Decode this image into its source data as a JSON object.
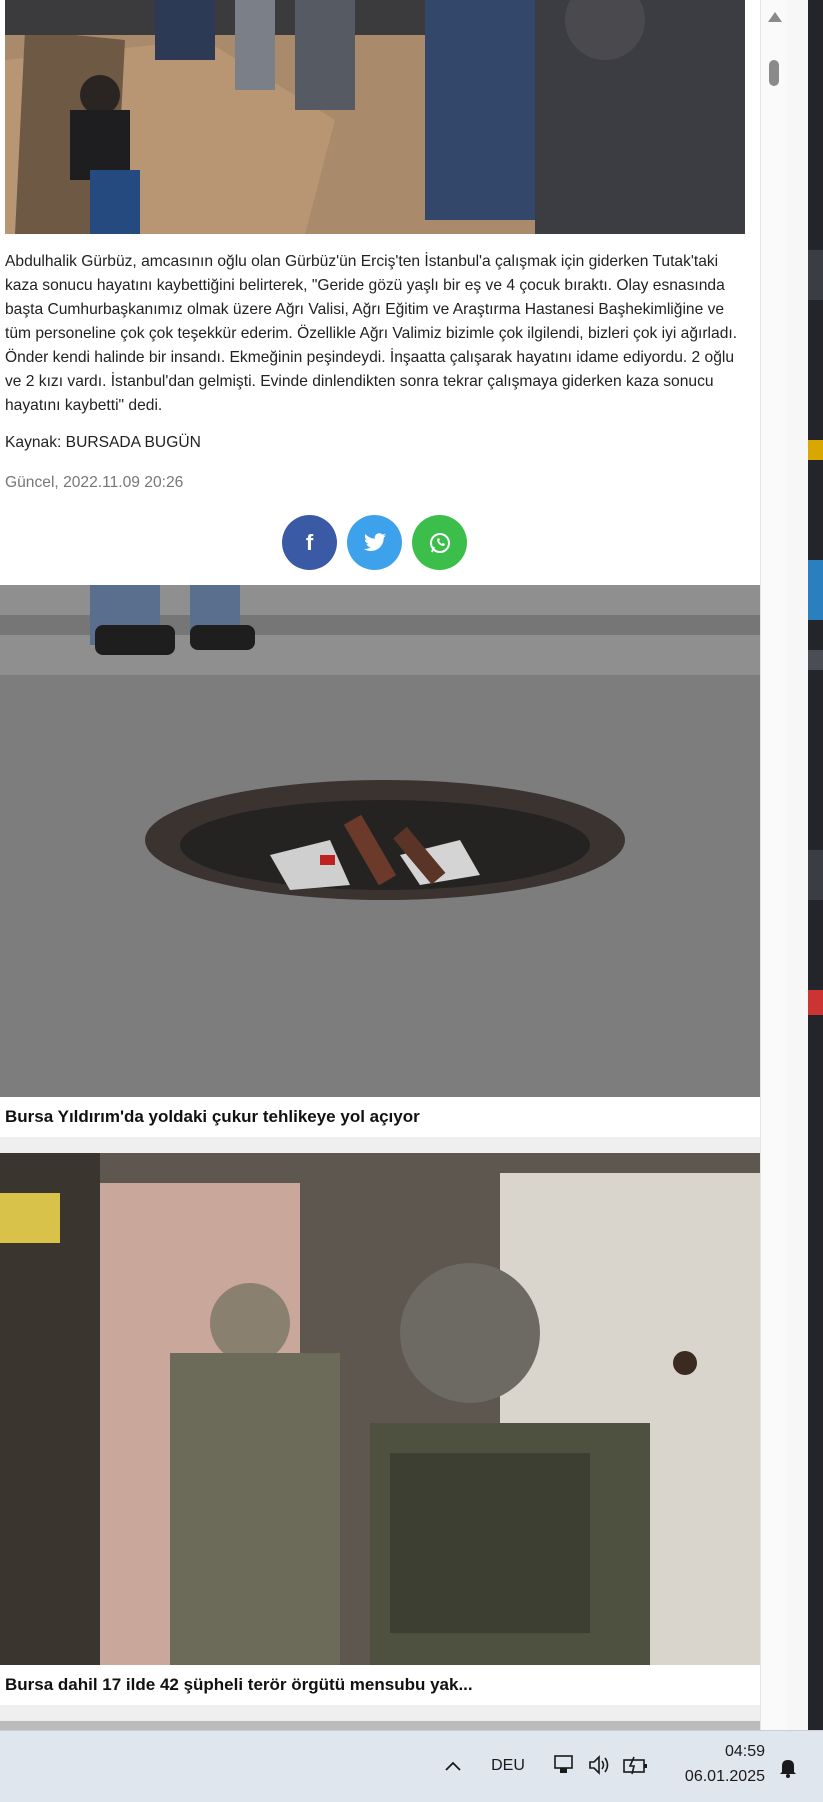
{
  "article": {
    "body": "Abdulhalik Gürbüz, amcasının oğlu olan Gürbüz'ün Erciş'ten İstanbul'a çalışmak için giderken Tutak'taki kaza sonucu hayatını kaybettiğini belirterek, \"Geride gözü yaşlı bir eş ve 4 çocuk bıraktı. Olay esnasında başta Cumhurbaşkanımız olmak üzere Ağrı Valisi, Ağrı Eğitim ve Araştırma Hastanesi Başhekimliğine ve tüm personeline çok çok teşekkür ederim. Özellikle Ağrı Valimiz bizimle çok ilgilendi, bizleri çok iyi ağırladı. Önder kendi halinde bir insandı. Ekmeğinin peşindeydi. İnşaatta çalışarak hayatını idame ediyordu. 2 oğlu ve 2 kızı vardı. İstanbul'dan gelmişti. Evinde dinlendikten sonra tekrar çalışmaya giderken kaza sonucu hayatını kaybetti\" dedi.",
    "source": "Kaynak: BURSADA BUGÜN",
    "updated": "Güncel, 2022.11.09 20:26"
  },
  "share": {
    "facebook": "f",
    "twitter": "twitter-icon",
    "whatsapp": "whatsapp-icon"
  },
  "related": [
    {
      "title": "Bursa Yıldırım'da yoldaki çukur tehlikeye yol açıyor"
    },
    {
      "title": "Bursa dahil 17 ilde 42 şüpheli terör örgütü mensubu yak..."
    }
  ],
  "taskbar": {
    "language": "DEU",
    "time": "04:59",
    "date": "06.01.2025"
  },
  "colors": {
    "facebook": "#3b5aa6",
    "twitter": "#3ea1ec",
    "whatsapp": "#3bbf4a",
    "taskbar": "#dfe6ee"
  }
}
